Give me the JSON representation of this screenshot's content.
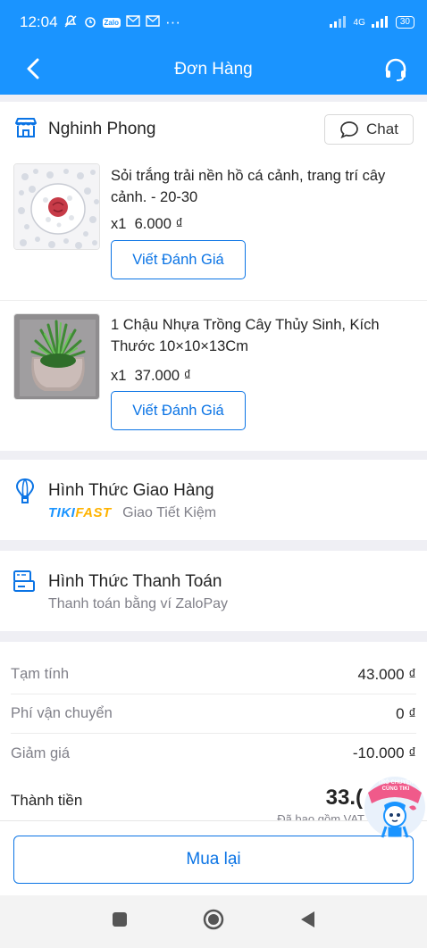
{
  "status_bar": {
    "time": "12:04",
    "network": "4G",
    "battery": "30"
  },
  "header": {
    "title": "Đơn Hàng"
  },
  "shop": {
    "name": "Nghinh Phong",
    "chat_label": "Chat"
  },
  "products": [
    {
      "name": "Sỏi trắng trải nền hồ cá cảnh, trang trí cây cảnh. - 20-30",
      "quantity": "x1",
      "price": "6.000 ₫",
      "review_label": "Viết Đánh Giá"
    },
    {
      "name": "1 Chậu Nhựa Trồng Cây Thủy Sinh, Kích Thước 10×10×13Cm",
      "quantity": "x1",
      "price": "37.000 ₫",
      "review_label": "Viết Đánh Giá"
    }
  ],
  "delivery": {
    "title": "Hình Thức Giao Hàng",
    "badge_tiki": "TIKI",
    "badge_fast": "FAST",
    "method": "Giao Tiết Kiệm"
  },
  "payment": {
    "title": "Hình Thức Thanh Toán",
    "method": "Thanh toán bằng ví ZaloPay"
  },
  "summary": {
    "subtotal_label": "Tạm tính",
    "subtotal_value": "43.000 ₫",
    "shipping_label": "Phí vận chuyển",
    "shipping_value": "0 ₫",
    "discount_label": "Giảm giá",
    "discount_value": "-10.000 ₫",
    "total_label": "Thành tiền",
    "total_value_partial": "33.(",
    "vat_note_partial": "Đã bao gồm VAT"
  },
  "actions": {
    "rebuy_label": "Mua lại"
  },
  "mascot": {
    "text": "TRÒ CHUYỆN CÙNG TIKI"
  },
  "colors": {
    "brand": "#1a94ff",
    "link": "#0b74e5",
    "tikifast_yellow": "#ffb300"
  }
}
